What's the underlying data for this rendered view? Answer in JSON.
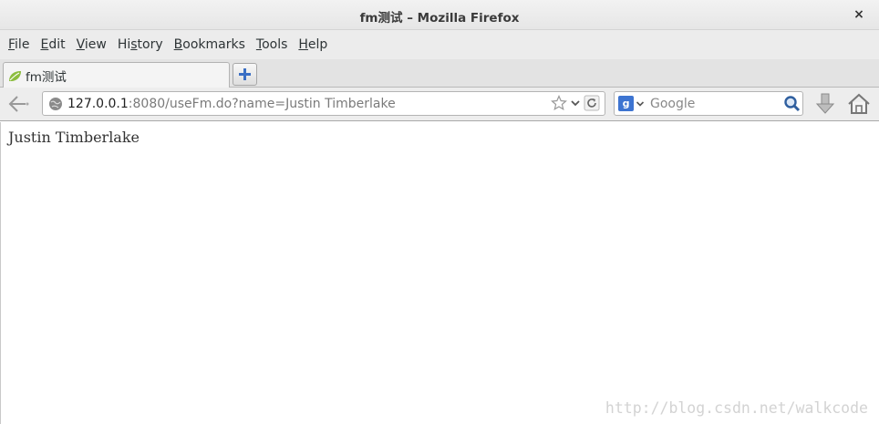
{
  "window": {
    "title": "fm测试 – Mozilla Firefox",
    "close_glyph": "×"
  },
  "menu": [
    {
      "accel": "F",
      "rest": "ile"
    },
    {
      "accel": "E",
      "rest": "dit"
    },
    {
      "accel": "V",
      "rest": "iew"
    },
    {
      "pre": "Hi",
      "accel": "s",
      "rest": "tory"
    },
    {
      "accel": "B",
      "rest": "ookmarks"
    },
    {
      "accel": "T",
      "rest": "ools"
    },
    {
      "accel": "H",
      "rest": "elp"
    }
  ],
  "tab": {
    "label": "fm测试",
    "favicon": "leaf-icon"
  },
  "url": {
    "host": "127.0.0.1",
    "rest": ":8080/useFm.do?name=Justin Timberlake"
  },
  "search": {
    "engine_glyph": "g",
    "placeholder": "Google"
  },
  "page": {
    "text": "Justin Timberlake"
  },
  "watermark": "http://blog.csdn.net/walkcode",
  "colors": {
    "accent": "#3d74d1",
    "leaf": "#8cbd3f"
  }
}
